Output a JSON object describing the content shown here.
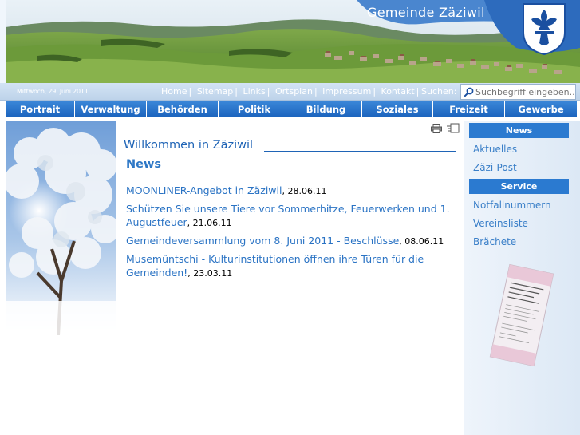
{
  "header": {
    "site_title": "Gemeinde Zäziwil"
  },
  "utility_bar": {
    "date": "Mittwoch, 29. Juni 2011",
    "links": [
      {
        "label": "Home"
      },
      {
        "label": "Sitemap"
      },
      {
        "label": "Links"
      },
      {
        "label": "Ortsplan"
      },
      {
        "label": "Impressum"
      },
      {
        "label": "Kontakt"
      }
    ],
    "separator": "|",
    "search_label": "Suchen:",
    "search_placeholder": "Suchbegriff eingeben..."
  },
  "nav": {
    "items": [
      {
        "label": "Portrait"
      },
      {
        "label": "Verwaltung"
      },
      {
        "label": "Behörden"
      },
      {
        "label": "Politik"
      },
      {
        "label": "Bildung"
      },
      {
        "label": "Soziales"
      },
      {
        "label": "Freizeit"
      },
      {
        "label": "Gewerbe"
      }
    ]
  },
  "main": {
    "title": "Willkommen in Zäziwil",
    "news_heading": "News",
    "news": [
      {
        "title": "MOONLINER-Angebot in Zäziwil",
        "date": "28.06.11"
      },
      {
        "title": "Schützen Sie unsere Tiere vor Sommerhitze, Feuerwerken und 1. Augustfeuer",
        "date": "21.06.11"
      },
      {
        "title": "Gemeindeversammlung vom 8. Juni 2011 - Beschlüsse",
        "date": "08.06.11"
      },
      {
        "title": "Musemüntschi - Kulturinstitutionen öffnen ihre Türen für die Gemeinden!",
        "date": "23.03.11"
      }
    ]
  },
  "sidebar": {
    "news_heading": "News",
    "news_links": [
      {
        "label": "Aktuelles"
      },
      {
        "label": "Zäzi-Post"
      }
    ],
    "service_heading": "Service",
    "service_links": [
      {
        "label": "Notfallnummern"
      },
      {
        "label": "Vereinsliste"
      },
      {
        "label": "Brächete"
      }
    ]
  },
  "colors": {
    "nav_blue": "#2b7ad0",
    "link_blue": "#2a73c4",
    "title_blue": "#1f64b6",
    "sky_blue": "#5f97d6"
  },
  "icons": [
    "search-icon",
    "print-icon",
    "mail-icon",
    "crest-icon"
  ]
}
